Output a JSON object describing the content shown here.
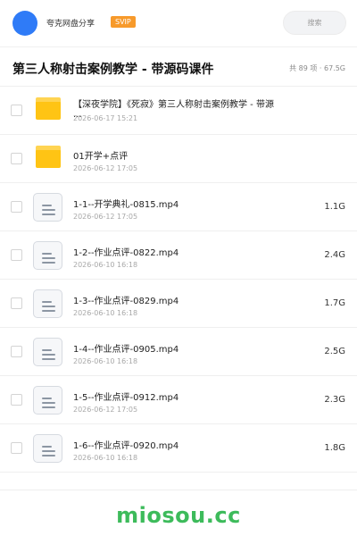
{
  "header": {
    "share_name": "夸克网盘分享",
    "badge": "SVIP",
    "search_placeholder": "搜索"
  },
  "folder": {
    "title": "第三人称射击案例教学 - 带源码课件",
    "meta": "共 89 项 · 67.5G"
  },
  "files": [
    {
      "type": "folder",
      "name": "【深夜学院】《死寂》第三人称射击案例教学 - 带源···",
      "date": "2026-06-17 15:21",
      "size": ""
    },
    {
      "type": "folder",
      "name": "01开学+点评",
      "date": "2026-06-12 17:05",
      "size": ""
    },
    {
      "type": "file",
      "name": "1-1--开学典礼-0815.mp4",
      "date": "2026-06-12 17:05",
      "size": "1.1G"
    },
    {
      "type": "file",
      "name": "1-2--作业点评-0822.mp4",
      "date": "2026-06-10 16:18",
      "size": "2.4G"
    },
    {
      "type": "file",
      "name": "1-3--作业点评-0829.mp4",
      "date": "2026-06-10 16:18",
      "size": "1.7G"
    },
    {
      "type": "file",
      "name": "1-4--作业点评-0905.mp4",
      "date": "2026-06-10 16:18",
      "size": "2.5G"
    },
    {
      "type": "file",
      "name": "1-5--作业点评-0912.mp4",
      "date": "2026-06-12 17:05",
      "size": "2.3G"
    },
    {
      "type": "file",
      "name": "1-6--作业点评-0920.mp4",
      "date": "2026-06-10 16:18",
      "size": "1.8G"
    }
  ],
  "watermark": "miosou.cc",
  "colors": {
    "avatar": "#2f7bf7",
    "badge": "#f79a2b",
    "folder": "#ffc414",
    "watermark": "#3dbb5b"
  }
}
